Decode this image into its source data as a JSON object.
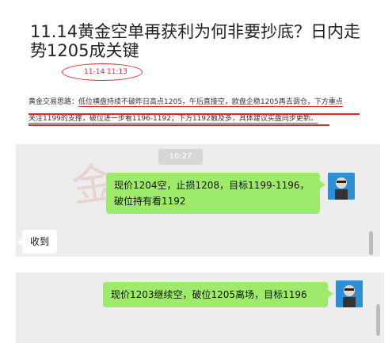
{
  "article": {
    "title": "11.14黄金空单再获利为何非要抄底？日内走势1205成关键",
    "date": "11-14 11:13",
    "summary": {
      "prefix": "黄金交易思路：",
      "underlined_1": "低位横盘持续不破昨日高点1205，午后直接空，欧盘企稳1205再去调仓，下方重点",
      "underlined_2": "关注1199的支撑，破位进一步看1196-1192；下方1192触及多，具体建议实盘同步更新。"
    }
  },
  "chat": {
    "time_label": "10:27",
    "msg1": "现价1204空，止损1208，目标1199-1196，破位持有看1192",
    "msg2": "收到",
    "msg3": "现价1203继续空，破位1205离场，目标1196"
  },
  "watermark_text": "金",
  "icons": {
    "avatar1": "user-avatar-icon",
    "avatar2": "user-avatar-icon"
  },
  "colors": {
    "accent_red": "#d52a2a",
    "bubble_green": "#9eea6a",
    "chat_bg": "#ededed"
  }
}
